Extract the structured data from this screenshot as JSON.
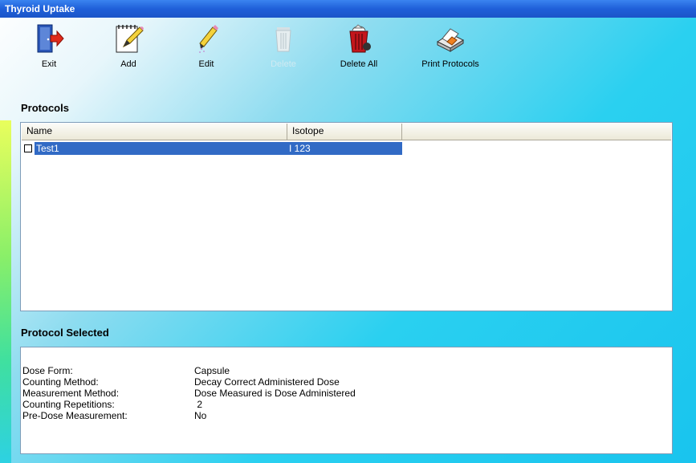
{
  "window": {
    "title": "Thyroid Uptake"
  },
  "toolbar": {
    "exit": "Exit",
    "add": "Add",
    "edit": "Edit",
    "delete": "Delete",
    "delete_all": "Delete All",
    "print_protocols": "Print Protocols"
  },
  "protocols": {
    "title": "Protocols",
    "columns": [
      "Name",
      "Isotope"
    ],
    "rows": [
      {
        "name": "Test1",
        "isotope": "I 123",
        "checked": false,
        "selected": true
      }
    ]
  },
  "protocol_selected": {
    "title": "Protocol Selected",
    "fields": [
      {
        "label": "Dose Form:",
        "value": "Capsule"
      },
      {
        "label": "Counting Method:",
        "value": "Decay Correct Administered Dose"
      },
      {
        "label": "Measurement Method:",
        "value": "Dose Measured is Dose Administered"
      },
      {
        "label": "Counting Repetitions:",
        "value": " 2"
      },
      {
        "label": "Pre-Dose Measurement:",
        "value": "No"
      }
    ]
  },
  "colors": {
    "title_bar": "#1f5fd9",
    "selection": "#316ac5",
    "background_cyan": "#19c4ee"
  }
}
